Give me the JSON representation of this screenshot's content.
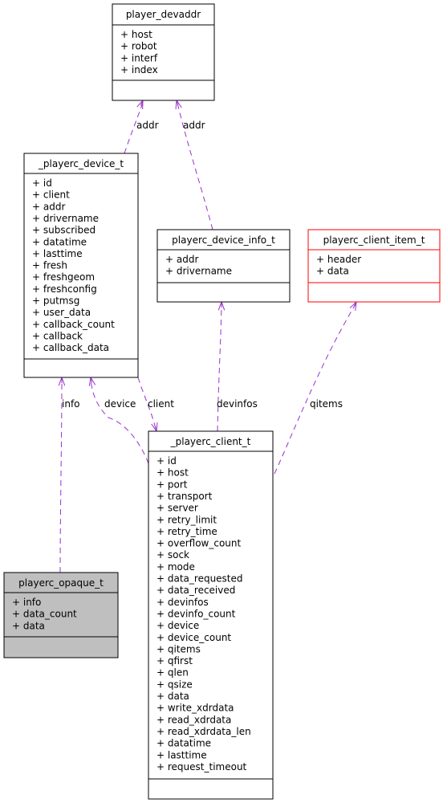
{
  "colors": {
    "edge": "#9a32cd",
    "highlight_fill": "#bfbfbf",
    "incomplete_border": "#ff0000"
  },
  "classes": [
    {
      "id": "player_devaddr",
      "title": "player_devaddr",
      "fields": [
        "+ host",
        "+ robot",
        "+ interf",
        "+ index"
      ]
    },
    {
      "id": "playerc_device_t",
      "title": "_playerc_device_t",
      "fields": [
        "+ id",
        "+ client",
        "+ addr",
        "+ drivername",
        "+ subscribed",
        "+ datatime",
        "+ lasttime",
        "+ fresh",
        "+ freshgeom",
        "+ freshconfig",
        "+ putmsg",
        "+ user_data",
        "+ callback_count",
        "+ callback",
        "+ callback_data"
      ]
    },
    {
      "id": "playerc_device_info_t",
      "title": "playerc_device_info_t",
      "fields": [
        "+ addr",
        "+ drivername"
      ]
    },
    {
      "id": "playerc_client_item_t",
      "title": "playerc_client_item_t",
      "fields": [
        "+ header",
        "+ data"
      ],
      "border": "#ff0000"
    },
    {
      "id": "playerc_client_t",
      "title": "_playerc_client_t",
      "fields": [
        "+ id",
        "+ host",
        "+ port",
        "+ transport",
        "+ server",
        "+ retry_limit",
        "+ retry_time",
        "+ overflow_count",
        "+ sock",
        "+ mode",
        "+ data_requested",
        "+ data_received",
        "+ devinfos",
        "+ devinfo_count",
        "+ device",
        "+ device_count",
        "+ qitems",
        "+ qfirst",
        "+ qlen",
        "+ qsize",
        "+ data",
        "+ write_xdrdata",
        "+ read_xdrdata",
        "+ read_xdrdata_len",
        "+ datatime",
        "+ lasttime",
        "+ request_timeout"
      ]
    },
    {
      "id": "playerc_opaque_t",
      "title": "playerc_opaque_t",
      "fields": [
        "+ info",
        "+ data_count",
        "+ data"
      ],
      "fill": "#bfbfbf"
    }
  ],
  "edges": [
    {
      "from": "playerc_device_t",
      "to": "player_devaddr",
      "label": "addr"
    },
    {
      "from": "playerc_device_info_t",
      "to": "player_devaddr",
      "label": "addr"
    },
    {
      "from": "playerc_opaque_t",
      "to": "playerc_device_t",
      "label": "info"
    },
    {
      "from": "playerc_client_t",
      "to": "playerc_device_t",
      "label": "device"
    },
    {
      "from": "playerc_device_t",
      "to": "playerc_client_t",
      "label": "client"
    },
    {
      "from": "playerc_client_t",
      "to": "playerc_device_info_t",
      "label": "devinfos"
    },
    {
      "from": "playerc_client_t",
      "to": "playerc_client_item_t",
      "label": "qitems"
    }
  ]
}
